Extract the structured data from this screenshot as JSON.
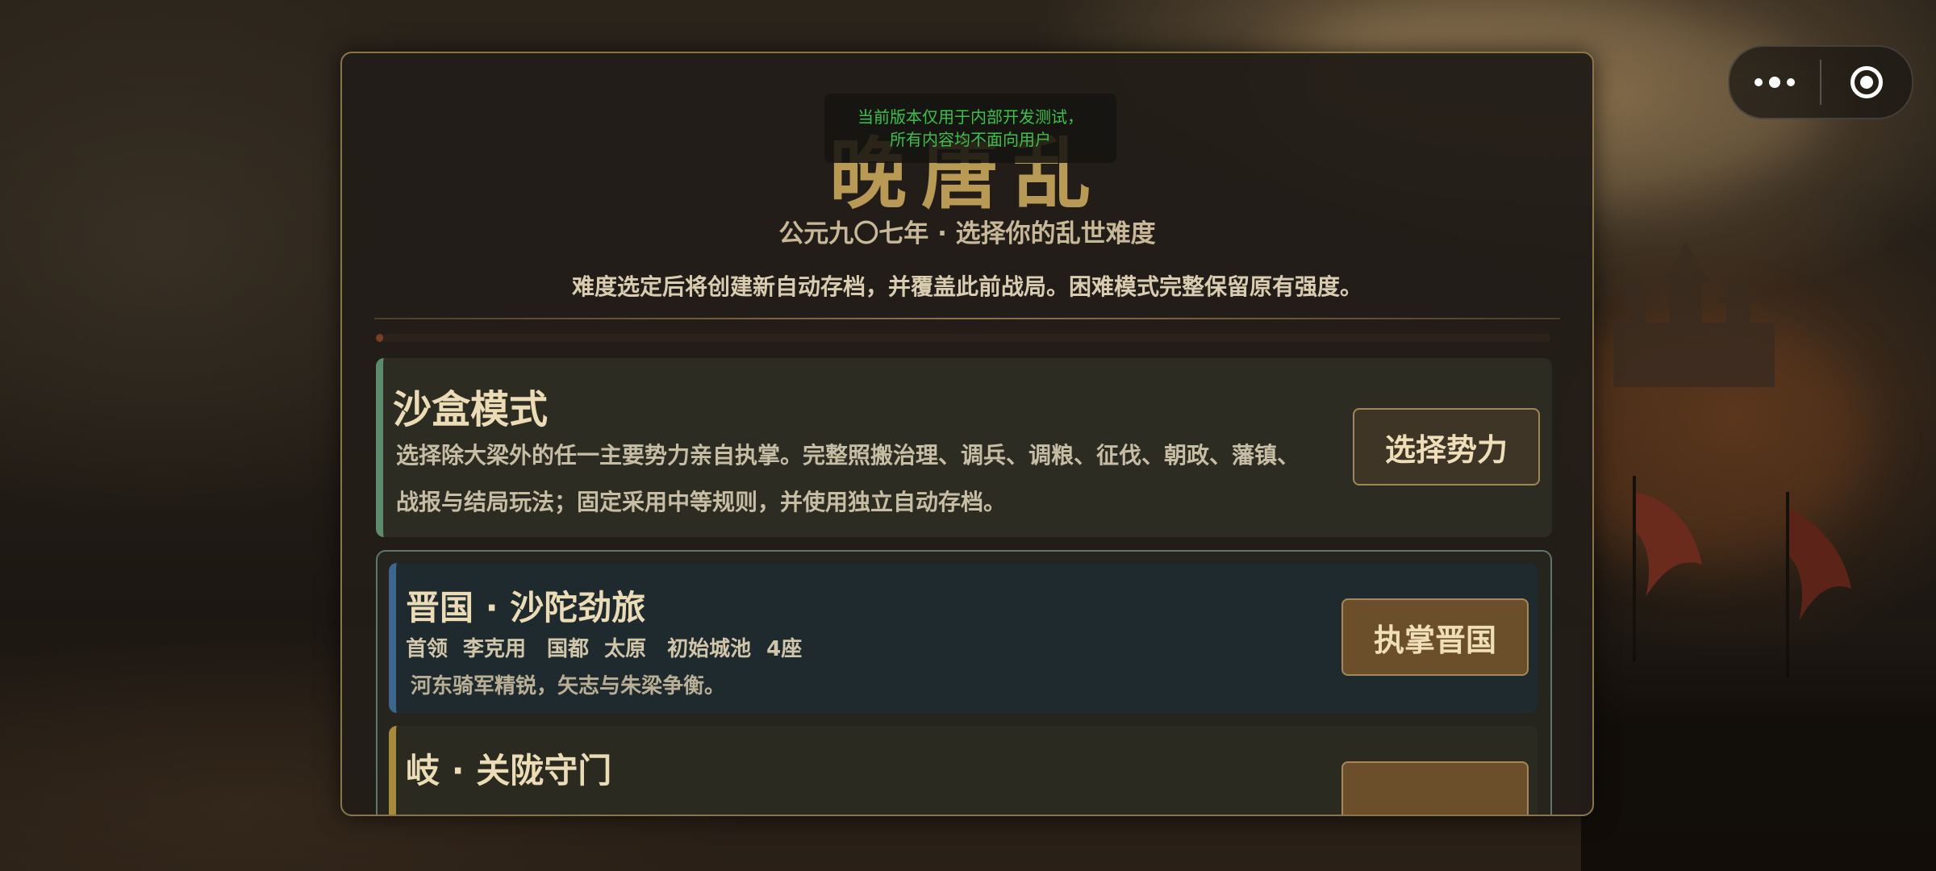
{
  "window_controls": {
    "more_icon": "more-dots-icon",
    "close_icon": "target-circle-icon"
  },
  "game": {
    "title": "晚唐乱",
    "dev_notice": [
      "当前版本仅用于内部开发测试，",
      "所有内容均不面向用户"
    ],
    "subtitle": "公元九〇七年 · 选择你的乱世难度",
    "description": "难度选定后将创建新自动存档，并覆盖此前战局。困难模式完整保留原有强度。",
    "progress_fraction": 0.006
  },
  "sandbox": {
    "name": "沙盒模式",
    "description": "选择除大梁外的任一主要势力亲自执掌。完整照搬治理、调兵、调粮、征伐、朝政、藩镇、战报与结局玩法；固定采用中等规则，并使用独立自动存档。",
    "button": "选择势力",
    "accent": "#5e8b6b"
  },
  "factions": [
    {
      "name": "晋国 · 沙陀劲旅",
      "meta": "首领 李克用　国都 太原　初始城池 4座",
      "flavor": "河东骑军精锐，矢志与朱梁争衡。",
      "button": "执掌晋国",
      "accent": "#3c6690"
    },
    {
      "name": "岐 · 关陇守门",
      "meta": "",
      "flavor": "",
      "button": "",
      "accent": "#a88a3c"
    }
  ]
}
